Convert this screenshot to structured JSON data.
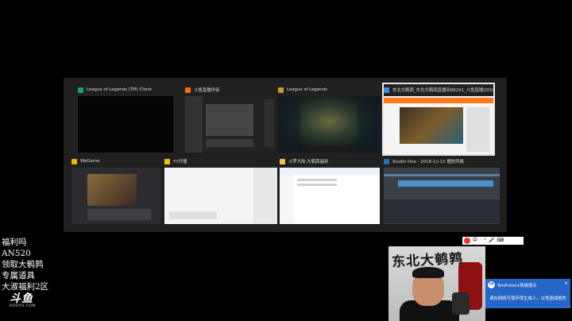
{
  "windows": [
    {
      "title": "League of Legends (TM) Client",
      "icon": "league-client-icon",
      "color": "#1aa06c"
    },
    {
      "title": "斗鱼直播伴侣",
      "icon": "douyu-companion-icon",
      "color": "#ff6a00"
    },
    {
      "title": "League of Legends",
      "icon": "league-icon",
      "color": "#c89b3c"
    },
    {
      "title": "东北大鹌鹑_东北大鹌鹑直播间96291_斗鱼直播(DOUYU...",
      "icon": "browser-icon",
      "color": "#3a8ee6"
    },
    {
      "title": "WeGame",
      "icon": "wegame-icon",
      "color": "#f2b705"
    },
    {
      "title": "YY开播",
      "icon": "yy-icon",
      "color": "#f2c200"
    },
    {
      "title": "斗罗大陆 大鹌鹑福利",
      "icon": "folder-icon",
      "color": "#f6c445"
    },
    {
      "title": "Studio One - 2018-12-11 播放风格",
      "icon": "studio-one-icon",
      "color": "#2b6cb0"
    }
  ],
  "overlay_lines": [
    "福利吗",
    "AN520",
    "领取大鹌鹑",
    "专属道具",
    "大淑福利2区"
  ],
  "douyu_logo": {
    "mark": "斗鱼",
    "sub": "DOUYU.COM"
  },
  "ime_bar": [
    "中",
    "·",
    "°",
    "🎤",
    "⌨"
  ],
  "webcam": {
    "banner": "东北大鹌鹑"
  },
  "toast": {
    "app": "TenProtect系统提示",
    "message": "请在网络可靠环境生成人，以免造成损失"
  }
}
